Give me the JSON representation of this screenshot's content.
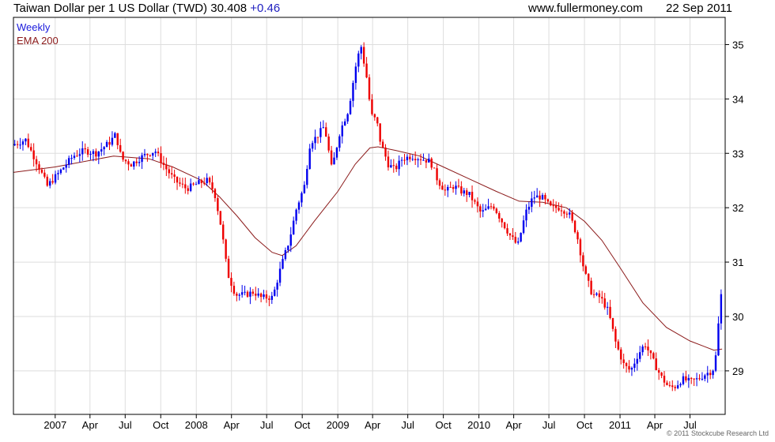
{
  "header": {
    "title": "Taiwan Dollar per 1 US Dollar (TWD) 30.408",
    "change": "+0.46",
    "site": "www.fullermoney.com",
    "date": "22 Sep 2011"
  },
  "footer": {
    "copyright": "© 2011 Stockcube Research Ltd"
  },
  "chart_data": {
    "type": "candlestick",
    "legend": [
      {
        "name": "Weekly",
        "color": "#1a1adc"
      },
      {
        "name": "EMA 200",
        "color": "#8b1a1a"
      }
    ],
    "colors": {
      "up": "#0000ee",
      "down": "#ee0000",
      "ema": "#8b1a1a",
      "grid": "#dddddd"
    },
    "y_axis": {
      "position": "right",
      "ylim": [
        28.2,
        35.5
      ],
      "ticks": [
        29,
        30,
        31,
        32,
        33,
        34,
        35
      ]
    },
    "x_axis": {
      "range": [
        "2006-09-15",
        "2011-09-30"
      ],
      "ticks": [
        {
          "label": "2007",
          "date": "2007-01-01"
        },
        {
          "label": "Apr",
          "date": "2007-04-01"
        },
        {
          "label": "Jul",
          "date": "2007-07-01"
        },
        {
          "label": "Oct",
          "date": "2007-10-01"
        },
        {
          "label": "2008",
          "date": "2008-01-01"
        },
        {
          "label": "Apr",
          "date": "2008-04-01"
        },
        {
          "label": "Jul",
          "date": "2008-07-01"
        },
        {
          "label": "Oct",
          "date": "2008-10-01"
        },
        {
          "label": "2009",
          "date": "2009-01-01"
        },
        {
          "label": "Apr",
          "date": "2009-04-01"
        },
        {
          "label": "Jul",
          "date": "2009-07-01"
        },
        {
          "label": "Oct",
          "date": "2009-10-01"
        },
        {
          "label": "2010",
          "date": "2010-01-01"
        },
        {
          "label": "Apr",
          "date": "2010-04-01"
        },
        {
          "label": "Jul",
          "date": "2010-07-01"
        },
        {
          "label": "Oct",
          "date": "2010-10-01"
        },
        {
          "label": "2011",
          "date": "2011-01-01"
        },
        {
          "label": "Apr",
          "date": "2011-04-01"
        },
        {
          "label": "Jul",
          "date": "2011-07-01"
        }
      ]
    },
    "price_path": [
      [
        "2006-09-15",
        33.15
      ],
      [
        "2006-10-20",
        33.25
      ],
      [
        "2006-11-20",
        32.8
      ],
      [
        "2006-12-15",
        32.4
      ],
      [
        "2007-01-15",
        32.65
      ],
      [
        "2007-02-20",
        32.95
      ],
      [
        "2007-03-20",
        33.05
      ],
      [
        "2007-04-20",
        33.0
      ],
      [
        "2007-05-25",
        33.2
      ],
      [
        "2007-06-10",
        33.35
      ],
      [
        "2007-06-25",
        32.9
      ],
      [
        "2007-07-20",
        32.8
      ],
      [
        "2007-08-20",
        32.95
      ],
      [
        "2007-09-20",
        33.05
      ],
      [
        "2007-10-15",
        32.75
      ],
      [
        "2007-11-10",
        32.5
      ],
      [
        "2007-12-10",
        32.35
      ],
      [
        "2008-01-10",
        32.45
      ],
      [
        "2008-02-01",
        32.5
      ],
      [
        "2008-02-20",
        32.3
      ],
      [
        "2008-03-10",
        31.6
      ],
      [
        "2008-03-25",
        30.8
      ],
      [
        "2008-04-15",
        30.4
      ],
      [
        "2008-05-10",
        30.4
      ],
      [
        "2008-06-01",
        30.45
      ],
      [
        "2008-06-20",
        30.35
      ],
      [
        "2008-07-20",
        30.35
      ],
      [
        "2008-08-10",
        30.9
      ],
      [
        "2008-09-01",
        31.4
      ],
      [
        "2008-09-20",
        32.0
      ],
      [
        "2008-10-10",
        32.4
      ],
      [
        "2008-10-25",
        33.2
      ],
      [
        "2008-11-10",
        33.3
      ],
      [
        "2008-12-01",
        33.5
      ],
      [
        "2008-12-20",
        32.7
      ],
      [
        "2009-01-10",
        33.4
      ],
      [
        "2009-02-01",
        33.8
      ],
      [
        "2009-02-20",
        34.6
      ],
      [
        "2009-03-05",
        35.0
      ],
      [
        "2009-03-20",
        34.4
      ],
      [
        "2009-04-01",
        33.7
      ],
      [
        "2009-04-15",
        33.6
      ],
      [
        "2009-04-25",
        33.2
      ],
      [
        "2009-05-15",
        32.8
      ],
      [
        "2009-06-01",
        32.7
      ],
      [
        "2009-06-20",
        32.9
      ],
      [
        "2009-07-15",
        32.95
      ],
      [
        "2009-08-10",
        32.9
      ],
      [
        "2009-09-01",
        32.85
      ],
      [
        "2009-09-20",
        32.5
      ],
      [
        "2009-10-10",
        32.3
      ],
      [
        "2009-11-01",
        32.4
      ],
      [
        "2009-11-20",
        32.3
      ],
      [
        "2009-12-10",
        32.25
      ],
      [
        "2010-01-10",
        31.9
      ],
      [
        "2010-02-10",
        32.05
      ],
      [
        "2010-03-01",
        31.8
      ],
      [
        "2010-03-25",
        31.5
      ],
      [
        "2010-04-15",
        31.3
      ],
      [
        "2010-05-05",
        31.9
      ],
      [
        "2010-05-25",
        32.2
      ],
      [
        "2010-06-15",
        32.2
      ],
      [
        "2010-07-10",
        32.0
      ],
      [
        "2010-08-01",
        32.0
      ],
      [
        "2010-08-25",
        31.9
      ],
      [
        "2010-09-15",
        31.5
      ],
      [
        "2010-10-05",
        30.8
      ],
      [
        "2010-10-25",
        30.4
      ],
      [
        "2010-11-15",
        30.35
      ],
      [
        "2010-12-05",
        30.1
      ],
      [
        "2010-12-25",
        29.5
      ],
      [
        "2011-01-15",
        29.1
      ],
      [
        "2011-02-01",
        29.0
      ],
      [
        "2011-02-20",
        29.3
      ],
      [
        "2011-03-10",
        29.5
      ],
      [
        "2011-03-30",
        29.2
      ],
      [
        "2011-04-20",
        28.9
      ],
      [
        "2011-05-10",
        28.7
      ],
      [
        "2011-05-25",
        28.7
      ],
      [
        "2011-06-15",
        28.85
      ],
      [
        "2011-07-05",
        28.8
      ],
      [
        "2011-07-25",
        28.85
      ],
      [
        "2011-08-15",
        28.95
      ],
      [
        "2011-09-01",
        29.0
      ],
      [
        "2011-09-10",
        29.3
      ],
      [
        "2011-09-22",
        30.41
      ]
    ],
    "ema200": [
      [
        "2006-09-15",
        32.65
      ],
      [
        "2007-01-01",
        32.75
      ],
      [
        "2007-06-01",
        32.95
      ],
      [
        "2007-09-01",
        32.9
      ],
      [
        "2007-11-01",
        32.75
      ],
      [
        "2008-01-15",
        32.5
      ],
      [
        "2008-03-01",
        32.2
      ],
      [
        "2008-04-15",
        31.85
      ],
      [
        "2008-06-01",
        31.45
      ],
      [
        "2008-07-15",
        31.18
      ],
      [
        "2008-08-10",
        31.12
      ],
      [
        "2008-09-15",
        31.3
      ],
      [
        "2008-11-01",
        31.75
      ],
      [
        "2009-01-01",
        32.3
      ],
      [
        "2009-02-15",
        32.8
      ],
      [
        "2009-03-25",
        33.1
      ],
      [
        "2009-04-15",
        33.12
      ],
      [
        "2009-06-01",
        33.05
      ],
      [
        "2009-08-01",
        32.95
      ],
      [
        "2009-10-01",
        32.75
      ],
      [
        "2009-12-01",
        32.55
      ],
      [
        "2010-02-15",
        32.3
      ],
      [
        "2010-04-15",
        32.12
      ],
      [
        "2010-06-15",
        32.1
      ],
      [
        "2010-08-15",
        32.0
      ],
      [
        "2010-10-01",
        31.75
      ],
      [
        "2010-11-15",
        31.4
      ],
      [
        "2011-01-01",
        30.9
      ],
      [
        "2011-03-01",
        30.25
      ],
      [
        "2011-05-01",
        29.8
      ],
      [
        "2011-07-01",
        29.55
      ],
      [
        "2011-09-01",
        29.38
      ],
      [
        "2011-09-22",
        29.4
      ]
    ]
  }
}
